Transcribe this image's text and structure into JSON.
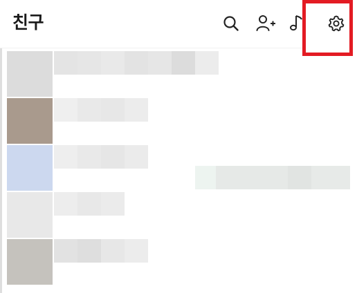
{
  "header": {
    "title": "친구",
    "icons": [
      "search-icon",
      "add-friend-icon",
      "music-icon",
      "settings-icon"
    ]
  },
  "colors": {
    "highlight": "#e31b23",
    "title": "#1a1a1a",
    "icon": "#222222",
    "background": "#ffffff"
  },
  "friends_list": {
    "rows": [
      {
        "avatar_color": "#dcdcdc",
        "label_colors": [
          "#e4e4e4",
          "#e6e6e6",
          "#e9e9e9",
          "#e3e3e3",
          "#e6e6e6",
          "#dcdcdc",
          "#ececec"
        ]
      },
      {
        "avatar_color": "#a99a8d",
        "label_colors": [
          "#efefef",
          "#e9e9e9",
          "#e7e7e7",
          "#ececec"
        ]
      },
      {
        "avatar_color": "#ccd8ef",
        "label_colors": [
          "#eeeeee",
          "#e9e9e9",
          "#e6e6e6",
          "#ebebeb"
        ],
        "status_colors": [
          "#edf4f0",
          "#e6e9e7",
          "#e1e4e2",
          "#e7eae8"
        ]
      },
      {
        "avatar_color": "#e8e8e8",
        "label_colors": [
          "#ededed",
          "#e8e8e8",
          "#ebebeb"
        ]
      },
      {
        "avatar_color": "#c5c2bd",
        "label_colors": [
          "#e2e2e2",
          "#dedede",
          "#e7e7e7",
          "#ececec"
        ]
      }
    ]
  }
}
